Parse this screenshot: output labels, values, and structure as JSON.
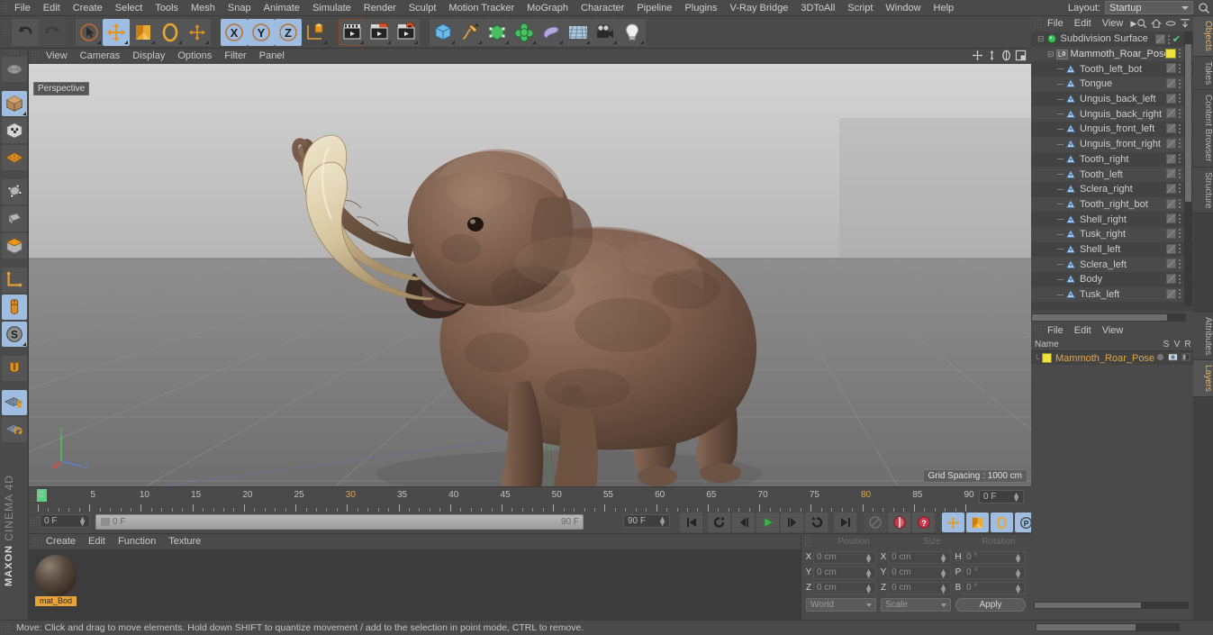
{
  "app": {
    "brand_top": "MAXON",
    "brand_bottom": "CINEMA 4D"
  },
  "menubar": {
    "items": [
      {
        "label": "File"
      },
      {
        "label": "Edit"
      },
      {
        "label": "Create"
      },
      {
        "label": "Select"
      },
      {
        "label": "Tools"
      },
      {
        "label": "Mesh"
      },
      {
        "label": "Snap"
      },
      {
        "label": "Animate"
      },
      {
        "label": "Simulate"
      },
      {
        "label": "Render"
      },
      {
        "label": "Sculpt"
      },
      {
        "label": "Motion Tracker"
      },
      {
        "label": "MoGraph"
      },
      {
        "label": "Character"
      },
      {
        "label": "Pipeline"
      },
      {
        "label": "Plugins"
      },
      {
        "label": "V-Ray Bridge"
      },
      {
        "label": "3DToAll"
      },
      {
        "label": "Script"
      },
      {
        "label": "Window"
      },
      {
        "label": "Help"
      }
    ],
    "layout_label": "Layout:",
    "layout_value": "Startup",
    "search_icon": "magnifier-icon"
  },
  "toolbar": {
    "groups": [
      {
        "name": "history",
        "buttons": [
          {
            "name": "undo-button",
            "icon": "undo-arrow-icon",
            "state": "normal"
          },
          {
            "name": "redo-button",
            "icon": "redo-arrow-icon",
            "state": "disabled"
          }
        ]
      },
      {
        "name": "tools",
        "buttons": [
          {
            "name": "live-selection-tool",
            "icon": "cursor-circle-icon",
            "state": "normal"
          },
          {
            "name": "move-tool",
            "icon": "move-arrows-icon",
            "state": "selected"
          },
          {
            "name": "scale-tool",
            "icon": "scale-box-icon",
            "state": "normal"
          },
          {
            "name": "rotate-tool",
            "icon": "rotate-ring-icon",
            "state": "normal"
          },
          {
            "name": "place-tool",
            "icon": "plus-cross-icon",
            "state": "normal"
          }
        ]
      },
      {
        "name": "axis-locks",
        "buttons": [
          {
            "name": "lock-x-axis-button",
            "icon": "x-axis-icon",
            "label": "X",
            "state": "selected"
          },
          {
            "name": "lock-y-axis-button",
            "icon": "y-axis-icon",
            "label": "Y",
            "state": "selected"
          },
          {
            "name": "lock-z-axis-button",
            "icon": "z-axis-icon",
            "label": "Z",
            "state": "selected"
          },
          {
            "name": "world-object-coordinates-button",
            "icon": "world-axis-cube-icon",
            "state": "normal"
          }
        ]
      },
      {
        "name": "render",
        "buttons": [
          {
            "name": "render-view-button",
            "icon": "clapperboard-icon",
            "state": "normal"
          },
          {
            "name": "render-to-picture-viewer-button",
            "icon": "clapperboard-red-icon",
            "state": "normal"
          },
          {
            "name": "render-settings-button",
            "icon": "clapperboard-gear-icon",
            "state": "normal"
          }
        ]
      },
      {
        "name": "creation",
        "buttons": [
          {
            "name": "add-cube-button",
            "icon": "blue-cube-icon",
            "state": "normal"
          },
          {
            "name": "add-spline-button",
            "icon": "pen-spline-icon",
            "state": "normal"
          },
          {
            "name": "add-generator-button",
            "icon": "green-cube-icon",
            "state": "normal"
          },
          {
            "name": "add-array-button",
            "icon": "green-cluster-icon",
            "state": "normal"
          },
          {
            "name": "add-deformer-button",
            "icon": "purple-bend-icon",
            "state": "normal"
          },
          {
            "name": "add-environment-button",
            "icon": "floor-grid-icon",
            "state": "normal"
          },
          {
            "name": "add-camera-button",
            "icon": "camera-icon",
            "state": "normal"
          },
          {
            "name": "add-light-button",
            "icon": "lightbulb-icon",
            "state": "normal"
          }
        ]
      }
    ]
  },
  "left_toolbar": {
    "buttons": [
      {
        "name": "make-editable-button",
        "icon": "make-editable-icon",
        "state": "normal"
      },
      {
        "name": "model-mode-button",
        "icon": "model-cube-icon",
        "state": "selected"
      },
      {
        "name": "texture-mode-button",
        "icon": "texture-cube-icon",
        "state": "normal"
      },
      {
        "name": "uv-mesh-mode-button",
        "icon": "uv-mesh-icon",
        "state": "normal"
      },
      {
        "name": "points-mode-button",
        "icon": "points-cube-icon",
        "state": "normal"
      },
      {
        "name": "edges-mode-button",
        "icon": "edges-cube-icon",
        "state": "normal"
      },
      {
        "name": "polygons-mode-button",
        "icon": "polygons-cube-icon",
        "state": "normal"
      },
      {
        "name": "object-axis-mode-button",
        "icon": "axis-angle-icon",
        "state": "normal"
      },
      {
        "name": "viewport-solo-button",
        "icon": "mouse-icon",
        "state": "selected"
      },
      {
        "name": "snap-settings-button",
        "icon": "s-circle-icon",
        "state": "selected"
      },
      {
        "name": "magnet-tool-button",
        "icon": "magnet-icon",
        "state": "normal"
      },
      {
        "name": "workplane-lock-button",
        "icon": "plane-lock-icon",
        "state": "selected"
      },
      {
        "name": "workplane-reset-button",
        "icon": "plane-reset-icon",
        "state": "normal"
      }
    ]
  },
  "viewport": {
    "menu": [
      {
        "label": "View"
      },
      {
        "label": "Cameras"
      },
      {
        "label": "Display"
      },
      {
        "label": "Options"
      },
      {
        "label": "Filter"
      },
      {
        "label": "Panel"
      }
    ],
    "nav_icons": [
      {
        "name": "pan-view-icon"
      },
      {
        "name": "zoom-view-icon"
      },
      {
        "name": "rotate-view-icon"
      },
      {
        "name": "maximize-view-icon"
      }
    ],
    "perspective_label": "Perspective",
    "grid_spacing": "Grid Spacing : 1000 cm",
    "axis_labels": {
      "x": "X",
      "y": "Y",
      "z": "Z"
    },
    "scene_subject": "mammoth-3d-model"
  },
  "timeline": {
    "ruler_ticks": [
      "0",
      "5",
      "10",
      "15",
      "20",
      "25",
      "30",
      "35",
      "40",
      "45",
      "50",
      "55",
      "60",
      "65",
      "70",
      "75",
      "80",
      "85",
      "90"
    ],
    "highlighted_ticks": [
      "30",
      "80"
    ],
    "current_frame_right": "0 F",
    "current_frame_field": "0 F",
    "preview_start_field": "0 F",
    "preview_end_button": "90 F",
    "end_frame_field": "90 F",
    "transport": [
      {
        "name": "go-to-start-button",
        "icon": "skip-back-icon"
      },
      {
        "name": "play-backward-loop-button",
        "icon": "loop-ccw-icon"
      },
      {
        "name": "step-back-button",
        "icon": "prev-frame-icon"
      },
      {
        "name": "play-button",
        "icon": "play-icon"
      },
      {
        "name": "step-forward-button",
        "icon": "next-frame-icon"
      },
      {
        "name": "loop-button",
        "icon": "loop-cw-icon"
      },
      {
        "name": "go-to-end-button",
        "icon": "skip-forward-icon"
      },
      {
        "name": "record-active-objects-button",
        "icon": "record-disabled-icon"
      },
      {
        "name": "autokeying-button",
        "icon": "keyframe-red-icon"
      },
      {
        "name": "keyframe-selection-button",
        "icon": "question-red-icon"
      },
      {
        "name": "position-key-button",
        "icon": "move-key-icon"
      },
      {
        "name": "scale-key-button",
        "icon": "scale-key-icon"
      },
      {
        "name": "rotation-key-button",
        "icon": "rotate-key-icon"
      },
      {
        "name": "parameter-key-button",
        "icon": "p-key-icon"
      },
      {
        "name": "point-level-animation-button",
        "icon": "pla-dots-icon"
      },
      {
        "name": "keyframe-preset-button",
        "icon": "layers-key-icon"
      }
    ]
  },
  "material_manager": {
    "menu": [
      {
        "label": "Create"
      },
      {
        "label": "Edit"
      },
      {
        "label": "Function"
      },
      {
        "label": "Texture"
      }
    ],
    "materials": [
      {
        "name": "mat_Bod",
        "full_name": "mat_Body"
      }
    ]
  },
  "coordinates": {
    "headers": [
      "Position",
      "Size",
      "Rotation"
    ],
    "rows": [
      {
        "axis": "X",
        "position": "0 cm",
        "size": "0 cm",
        "rot_label": "H",
        "rotation": "0 °"
      },
      {
        "axis": "Y",
        "position": "0 cm",
        "size": "0 cm",
        "rot_label": "P",
        "rotation": "0 °"
      },
      {
        "axis": "Z",
        "position": "0 cm",
        "size": "0 cm",
        "rot_label": "B",
        "rotation": "0 °"
      }
    ],
    "system": "World",
    "mode": "Scale",
    "apply_label": "Apply"
  },
  "object_manager": {
    "menu": [
      {
        "label": "File"
      },
      {
        "label": "Edit"
      },
      {
        "label": "View"
      }
    ],
    "menu_more": "more-chevron-icon",
    "icons": [
      {
        "name": "search-objects-icon"
      },
      {
        "name": "home-object-icon"
      },
      {
        "name": "ellipse-object-icon"
      },
      {
        "name": "fit-objects-icon"
      }
    ],
    "items": [
      {
        "label": "Subdivision Surface",
        "depth": 0,
        "icon": "subdivision-surface-icon",
        "has_check": true
      },
      {
        "label": "Mammoth_Roar_Pose",
        "depth": 1,
        "icon": "layer0-icon",
        "swatch": "#efe23c"
      },
      {
        "label": "Tooth_left_bot",
        "depth": 2,
        "icon": "polygon-object-icon"
      },
      {
        "label": "Tongue",
        "depth": 2,
        "icon": "polygon-object-icon"
      },
      {
        "label": "Unguis_back_left",
        "depth": 2,
        "icon": "polygon-object-icon"
      },
      {
        "label": "Unguis_back_right",
        "depth": 2,
        "icon": "polygon-object-icon"
      },
      {
        "label": "Unguis_front_left",
        "depth": 2,
        "icon": "polygon-object-icon"
      },
      {
        "label": "Unguis_front_right",
        "depth": 2,
        "icon": "polygon-object-icon"
      },
      {
        "label": "Tooth_right",
        "depth": 2,
        "icon": "polygon-object-icon"
      },
      {
        "label": "Tooth_left",
        "depth": 2,
        "icon": "polygon-object-icon"
      },
      {
        "label": "Sclera_right",
        "depth": 2,
        "icon": "polygon-object-icon"
      },
      {
        "label": "Tooth_right_bot",
        "depth": 2,
        "icon": "polygon-object-icon"
      },
      {
        "label": "Shell_right",
        "depth": 2,
        "icon": "polygon-object-icon"
      },
      {
        "label": "Tusk_right",
        "depth": 2,
        "icon": "polygon-object-icon"
      },
      {
        "label": "Shell_left",
        "depth": 2,
        "icon": "polygon-object-icon"
      },
      {
        "label": "Sclera_left",
        "depth": 2,
        "icon": "polygon-object-icon"
      },
      {
        "label": "Body",
        "depth": 2,
        "icon": "polygon-object-icon"
      },
      {
        "label": "Tusk_left",
        "depth": 2,
        "icon": "polygon-object-icon"
      }
    ]
  },
  "layer_manager": {
    "menu": [
      {
        "label": "File"
      },
      {
        "label": "Edit"
      },
      {
        "label": "View"
      }
    ],
    "columns": [
      "Name",
      "S",
      "V",
      "R"
    ],
    "rows": [
      {
        "name": "Mammoth_Roar_Pose",
        "color": "#efe23c",
        "solo": "off",
        "view": "on",
        "render": "on"
      }
    ]
  },
  "right_tabs": {
    "top": [
      {
        "label": "Objects",
        "active": true
      },
      {
        "label": "Takes",
        "active": false
      },
      {
        "label": "Content Browser",
        "active": false
      },
      {
        "label": "Structure",
        "active": false
      }
    ],
    "bottom": [
      {
        "label": "Attributes",
        "active": false
      },
      {
        "label": "Layers",
        "active": true
      }
    ]
  },
  "status_bar": {
    "message": "Move: Click and drag to move elements. Hold down SHIFT to quantize movement / add to the selection in point mode, CTRL to remove."
  },
  "colors": {
    "chrome": "#4a4a4a",
    "panel": "#434343",
    "selected_tool": "#9fbde0",
    "accent_orange": "#e9a33a",
    "layer_yellow": "#efe23c",
    "play_green": "#3fb34f",
    "marker_green": "#5ad17f"
  }
}
